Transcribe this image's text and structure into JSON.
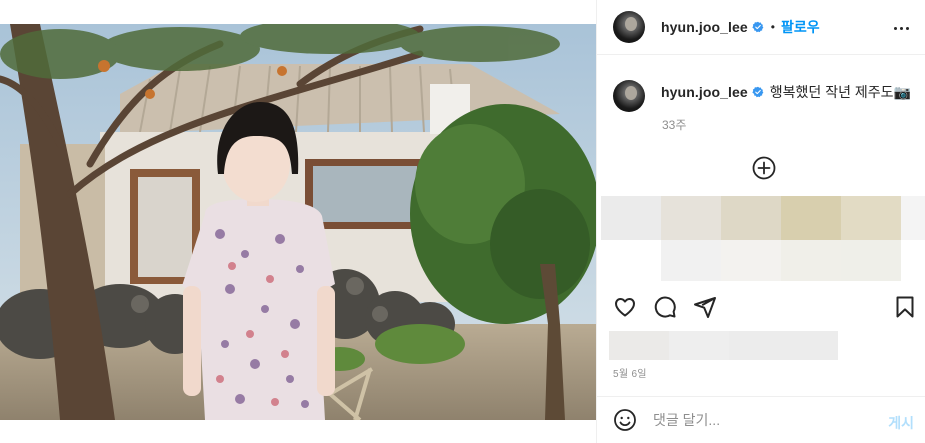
{
  "post": {
    "username": "hyun.joo_lee",
    "verified": true,
    "follow_label": "팔로우",
    "separator": "•",
    "more_icon": "more-horizontal-icon",
    "caption": "행복했던 작년 제주도📷",
    "time_ago": "33주",
    "load_more_icon": "plus-circle-icon",
    "date": "5월 6일"
  },
  "actions": {
    "like_icon": "heart-icon",
    "comment_icon": "comment-bubble-icon",
    "share_icon": "paper-plane-icon",
    "save_icon": "bookmark-icon"
  },
  "comment_bar": {
    "emoji_icon": "smiley-icon",
    "placeholder": "댓글 달기...",
    "value": "",
    "post_label": "게시"
  },
  "colors": {
    "accent": "#0095f6",
    "post_disabled": "#b2dffc",
    "verified_badge": "#3897f0",
    "secondary_text": "#8e8e8e"
  }
}
